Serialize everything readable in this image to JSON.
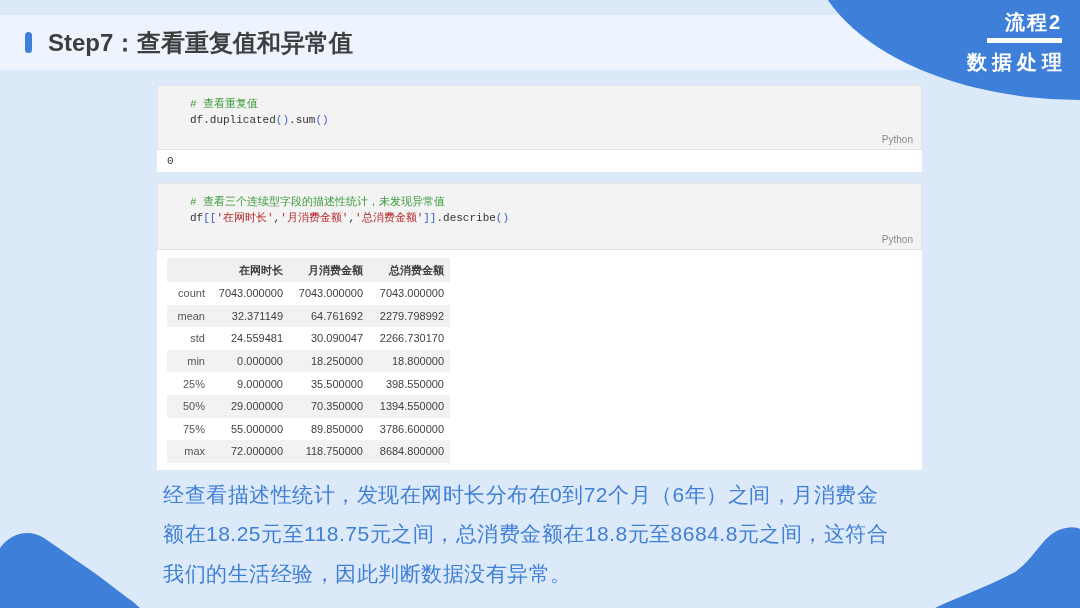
{
  "header": {
    "title": "Step7：查看重复值和异常值"
  },
  "badge": {
    "label": "流程2",
    "title": "数据处理"
  },
  "cells": [
    {
      "language": "Python",
      "code": [
        [
          {
            "kind": "comment",
            "text": "# 查看重复值"
          }
        ],
        [
          {
            "kind": "name",
            "text": "df.duplicated"
          },
          {
            "kind": "paren",
            "text": "()"
          },
          {
            "kind": "name",
            "text": ".sum"
          },
          {
            "kind": "paren",
            "text": "()"
          }
        ]
      ],
      "output": {
        "kind": "text",
        "text": "0"
      }
    },
    {
      "language": "Python",
      "code": [
        [
          {
            "kind": "comment",
            "text": "# 查看三个连续型字段的描述性统计，未发现异常值"
          }
        ],
        [
          {
            "kind": "name",
            "text": "df"
          },
          {
            "kind": "paren",
            "text": "[["
          },
          {
            "kind": "string",
            "text": "'在网时长'"
          },
          {
            "kind": "name",
            "text": ","
          },
          {
            "kind": "string",
            "text": "'月消费金额'"
          },
          {
            "kind": "name",
            "text": ","
          },
          {
            "kind": "string",
            "text": "'总消费金额'"
          },
          {
            "kind": "paren",
            "text": "]]"
          },
          {
            "kind": "name",
            "text": ".describe"
          },
          {
            "kind": "paren",
            "text": "()"
          }
        ]
      ],
      "output": {
        "kind": "table",
        "columns": [
          "在网时长",
          "月消费金额",
          "总消费金额"
        ],
        "rows": [
          {
            "label": "count",
            "values": [
              "7043.000000",
              "7043.000000",
              "7043.000000"
            ]
          },
          {
            "label": "mean",
            "values": [
              "32.371149",
              "64.761692",
              "2279.798992"
            ]
          },
          {
            "label": "std",
            "values": [
              "24.559481",
              "30.090047",
              "2266.730170"
            ]
          },
          {
            "label": "min",
            "values": [
              "0.000000",
              "18.250000",
              "18.800000"
            ]
          },
          {
            "label": "25%",
            "values": [
              "9.000000",
              "35.500000",
              "398.550000"
            ]
          },
          {
            "label": "50%",
            "values": [
              "29.000000",
              "70.350000",
              "1394.550000"
            ]
          },
          {
            "label": "75%",
            "values": [
              "55.000000",
              "89.850000",
              "3786.600000"
            ]
          },
          {
            "label": "max",
            "values": [
              "72.000000",
              "118.750000",
              "8684.800000"
            ]
          }
        ]
      }
    }
  ],
  "summary": "经查看描述性统计，发现在网时长分布在0到72个月（6年）之间，月消费金额在18.25元至118.75元之间，总消费金额在18.8元至8684.8元之间，这符合我们的生活经验，因此判断数据没有异常。"
}
